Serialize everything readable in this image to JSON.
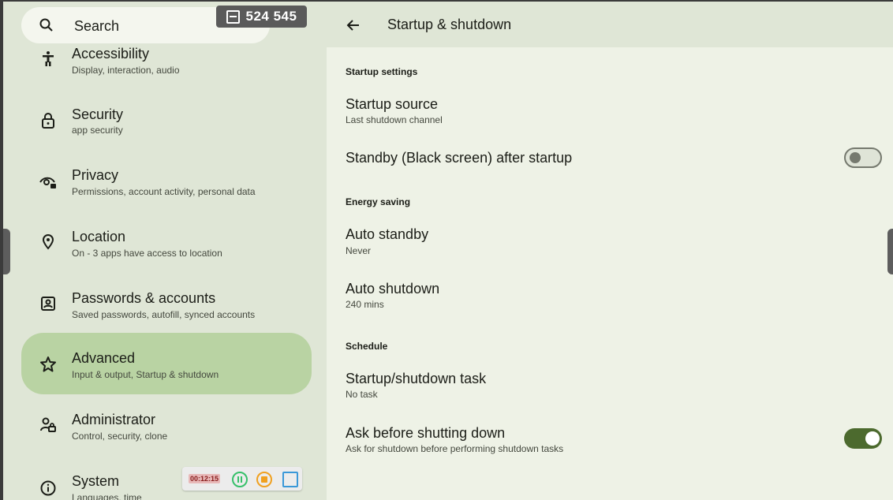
{
  "search": {
    "label": "Search"
  },
  "counter": {
    "value": "524 545"
  },
  "sidebar": {
    "items": [
      {
        "title": "Accessibility",
        "subtitle": "Display, interaction, audio"
      },
      {
        "title": "Security",
        "subtitle": "app security"
      },
      {
        "title": "Privacy",
        "subtitle": "Permissions, account activity, personal data"
      },
      {
        "title": "Location",
        "subtitle": "On - 3 apps have access to location"
      },
      {
        "title": "Passwords & accounts",
        "subtitle": "Saved passwords, autofill, synced accounts"
      },
      {
        "title": "Advanced",
        "subtitle": "Input & output, Startup & shutdown"
      },
      {
        "title": "Administrator",
        "subtitle": "Control, security, clone"
      },
      {
        "title": "System",
        "subtitle": "Languages, time"
      }
    ]
  },
  "recorder": {
    "time": "00:12:15"
  },
  "header": {
    "title": "Startup & shutdown"
  },
  "sections": {
    "startup": "Startup settings",
    "energy": "Energy saving",
    "schedule": "Schedule"
  },
  "prefs": {
    "startup_source": {
      "title": "Startup source",
      "subtitle": "Last shutdown channel"
    },
    "standby_after_startup": {
      "title": "Standby (Black screen) after startup",
      "enabled": false
    },
    "auto_standby": {
      "title": "Auto standby",
      "subtitle": "Never"
    },
    "auto_shutdown": {
      "title": "Auto shutdown",
      "subtitle": "240 mins"
    },
    "startup_shutdown_task": {
      "title": "Startup/shutdown task",
      "subtitle": "No task"
    },
    "ask_before_shutdown": {
      "title": "Ask before shutting down",
      "subtitle": "Ask for shutdown before performing shutdown tasks",
      "enabled": true
    }
  },
  "colors": {
    "accent": "#4c6a2e",
    "selected_item": "#b9d3a3",
    "sidebar_bg": "#dfe6d6",
    "content_bg": "#eef2e6"
  }
}
